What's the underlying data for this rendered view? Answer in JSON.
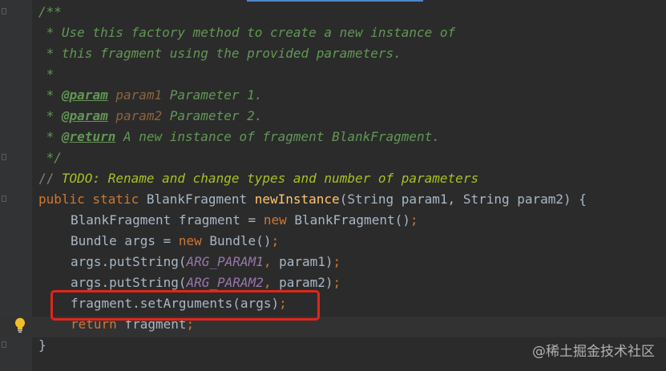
{
  "editor": {
    "lines": [
      {
        "indent": 1,
        "tokens": [
          {
            "c": "doc",
            "t": "/**"
          }
        ]
      },
      {
        "indent": 1,
        "tokens": [
          {
            "c": "doc",
            "t": " * Use this factory method to create a new instance of"
          }
        ]
      },
      {
        "indent": 1,
        "tokens": [
          {
            "c": "doc",
            "t": " * this fragment using the provided parameters."
          }
        ]
      },
      {
        "indent": 1,
        "tokens": [
          {
            "c": "doc",
            "t": " *"
          }
        ]
      },
      {
        "indent": 1,
        "tokens": [
          {
            "c": "doc",
            "t": " * "
          },
          {
            "c": "tag",
            "t": "@param"
          },
          {
            "c": "doc",
            "t": " "
          },
          {
            "c": "pname",
            "t": "param1"
          },
          {
            "c": "doc",
            "t": " Parameter 1."
          }
        ]
      },
      {
        "indent": 1,
        "tokens": [
          {
            "c": "doc",
            "t": " * "
          },
          {
            "c": "tag",
            "t": "@param"
          },
          {
            "c": "doc",
            "t": " "
          },
          {
            "c": "pname",
            "t": "param2"
          },
          {
            "c": "doc",
            "t": " Parameter 2."
          }
        ]
      },
      {
        "indent": 1,
        "tokens": [
          {
            "c": "doc",
            "t": " * "
          },
          {
            "c": "tag",
            "t": "@return"
          },
          {
            "c": "doc",
            "t": " A new instance of fragment BlankFragment."
          }
        ]
      },
      {
        "indent": 1,
        "tokens": [
          {
            "c": "doc",
            "t": " */"
          }
        ]
      },
      {
        "indent": 1,
        "tokens": [
          {
            "c": "cmt",
            "t": "// "
          },
          {
            "c": "todo",
            "t": "TODO: Rename and change types and number of parameters"
          }
        ]
      },
      {
        "indent": 1,
        "tokens": [
          {
            "c": "kw",
            "t": "public static "
          },
          {
            "c": "plain",
            "t": "BlankFragment "
          },
          {
            "c": "fn",
            "t": "newInstance"
          },
          {
            "c": "plain",
            "t": "(String param1, String param2) {"
          }
        ]
      },
      {
        "indent": 2,
        "tokens": [
          {
            "c": "plain",
            "t": "BlankFragment fragment = "
          },
          {
            "c": "kw",
            "t": "new "
          },
          {
            "c": "plain",
            "t": "BlankFragment()"
          },
          {
            "c": "kw",
            "t": ";"
          }
        ]
      },
      {
        "indent": 2,
        "tokens": [
          {
            "c": "plain",
            "t": "Bundle args = "
          },
          {
            "c": "kw",
            "t": "new "
          },
          {
            "c": "plain",
            "t": "Bundle()"
          },
          {
            "c": "kw",
            "t": ";"
          }
        ]
      },
      {
        "indent": 2,
        "tokens": [
          {
            "c": "plain",
            "t": "args.putString("
          },
          {
            "c": "const",
            "t": "ARG_PARAM1"
          },
          {
            "c": "kw",
            "t": ", "
          },
          {
            "c": "plain",
            "t": "param1)"
          },
          {
            "c": "kw",
            "t": ";"
          }
        ]
      },
      {
        "indent": 2,
        "tokens": [
          {
            "c": "plain",
            "t": "args.putString("
          },
          {
            "c": "const",
            "t": "ARG_PARAM2"
          },
          {
            "c": "kw",
            "t": ", "
          },
          {
            "c": "plain",
            "t": "param2)"
          },
          {
            "c": "kw",
            "t": ";"
          }
        ]
      },
      {
        "indent": 2,
        "tokens": [
          {
            "c": "plain",
            "t": "fragment.setArguments(args)"
          },
          {
            "c": "kw",
            "t": ";"
          }
        ]
      },
      {
        "indent": 2,
        "tokens": [
          {
            "c": "kw",
            "t": "return "
          },
          {
            "c": "plain",
            "t": "fragment"
          },
          {
            "c": "kw",
            "t": ";"
          }
        ]
      },
      {
        "indent": 1,
        "tokens": [
          {
            "c": "plain",
            "t": "}"
          }
        ]
      }
    ]
  },
  "gutter": {
    "intention_icon": "lightbulb-icon"
  },
  "highlight": {
    "color": "#e0261a"
  },
  "colors": {
    "background": "#2b2b2b",
    "doc_comment": "#629755",
    "keyword": "#cc7832",
    "method_name": "#ffc66d",
    "constant": "#9876aa"
  },
  "watermark": {
    "text": "@稀土掘金技术社区"
  }
}
